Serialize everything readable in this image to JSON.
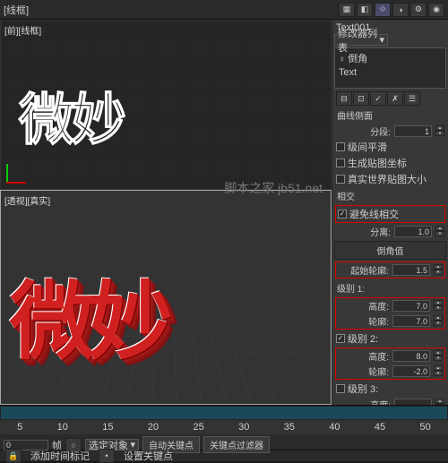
{
  "toolbar": {
    "view_mode": "[线框]",
    "obj_name": "Text001",
    "dd_label": "修改器列表"
  },
  "modifiers": {
    "item1": "倒角",
    "item2": "Text"
  },
  "viewports": {
    "top_label": "[前][线框]",
    "bot_label": "[透视][真实]",
    "wf": "微妙",
    "solid": "微妙",
    "watermark": "脚本之家 jb51.net"
  },
  "params": {
    "section1": "曲线侧面",
    "segs_lbl": "分段:",
    "segs_val": "1",
    "cb_smooth": "级间平滑",
    "cb_genmap": "生成贴图坐标",
    "cb_realworld": "真实世界贴图大小",
    "intersect_hdr": "相交",
    "cb_avoid": "避免线相交",
    "sep_lbl": "分离:",
    "sep_val": "1.0",
    "bevel_hdr": "倒角值",
    "start_outline_lbl": "起始轮廓:",
    "start_outline_val": "1.5",
    "lvl1": "级别 1:",
    "h1_lbl": "高度:",
    "h1_val": "7.0",
    "o1_lbl": "轮廓:",
    "o1_val": "7.0",
    "lvl2": "级别 2:",
    "h2_lbl": "高度:",
    "h2_val": "8.0",
    "o2_lbl": "轮廓:",
    "o2_val": "-2.0",
    "lvl3": "级别 3:",
    "h3_lbl": "高度:"
  },
  "timeline": {
    "val": "0",
    "frame": "帧",
    "sel_obj": "选定对象",
    "auto_key": "自动关键点",
    "set_key": "设置关键点",
    "key_filter": "关键点过滤器",
    "add_marker": "添加时间标记"
  },
  "ticks": [
    "5",
    "10",
    "15",
    "20",
    "25",
    "30",
    "35",
    "40",
    "45",
    "50"
  ]
}
